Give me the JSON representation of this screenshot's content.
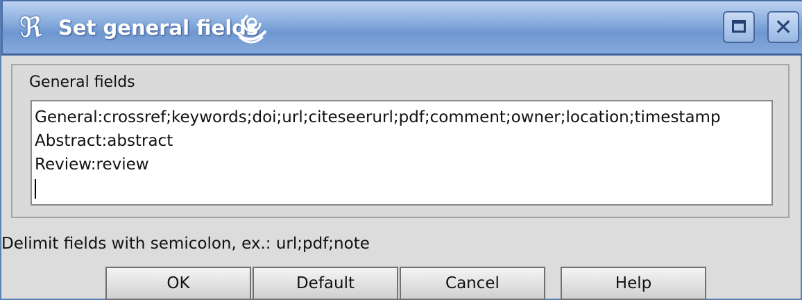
{
  "window": {
    "title": "Set general fields",
    "app_icon_glyph": "ℜ",
    "maximize_glyph": "□",
    "close_glyph": "✕"
  },
  "group": {
    "label": "General fields",
    "lines": [
      "General:crossref;keywords;doi;url;citeseerurl;pdf;comment;owner;location;timestamp",
      "Abstract:abstract",
      "Review:review"
    ]
  },
  "hint": "Delimit fields with semicolon, ex.: url;pdf;note",
  "buttons": {
    "ok": "OK",
    "default": "Default",
    "cancel": "Cancel",
    "help": "Help"
  },
  "colors": {
    "titlebar": "#7ea2d8",
    "background": "#dcdcdc",
    "title_text": "#ffffff"
  },
  "icons": [
    "app-logo-icon",
    "swirl-icon",
    "maximize-icon",
    "close-icon"
  ]
}
